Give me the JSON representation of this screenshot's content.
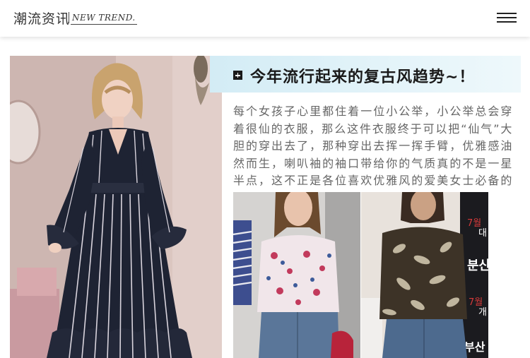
{
  "header": {
    "brand_cn": "潮流资讯",
    "brand_en": "NEW TREND.",
    "menu_icon": "menu-icon"
  },
  "article": {
    "title_icon": "plus-square-icon",
    "title": "今年流行起来的复古风趋势~！",
    "body": "每个女孩子心里都住着一位小公举，小公举总会穿着很仙的衣服，那么这件衣服终于可以把“仙气”大胆的穿出去了，那种穿出去挥一挥手臂，优雅感油然而生，喇叭袖的袖口带给你的气质真的不是一星半点，这不正是各位喜欢优雅风的爱美女士必备的嘛？"
  },
  "photos": {
    "bg_text_1": "7월",
    "bg_text_2": "대",
    "bg_text_3": "7월",
    "bg_text_4": "개",
    "bg_text_5": "부산",
    "bg_text_6": "분산"
  },
  "colors": {
    "banner": "#d3ecf5",
    "title": "#1a1a1a",
    "body": "#666666",
    "dress": "#1e2333"
  }
}
